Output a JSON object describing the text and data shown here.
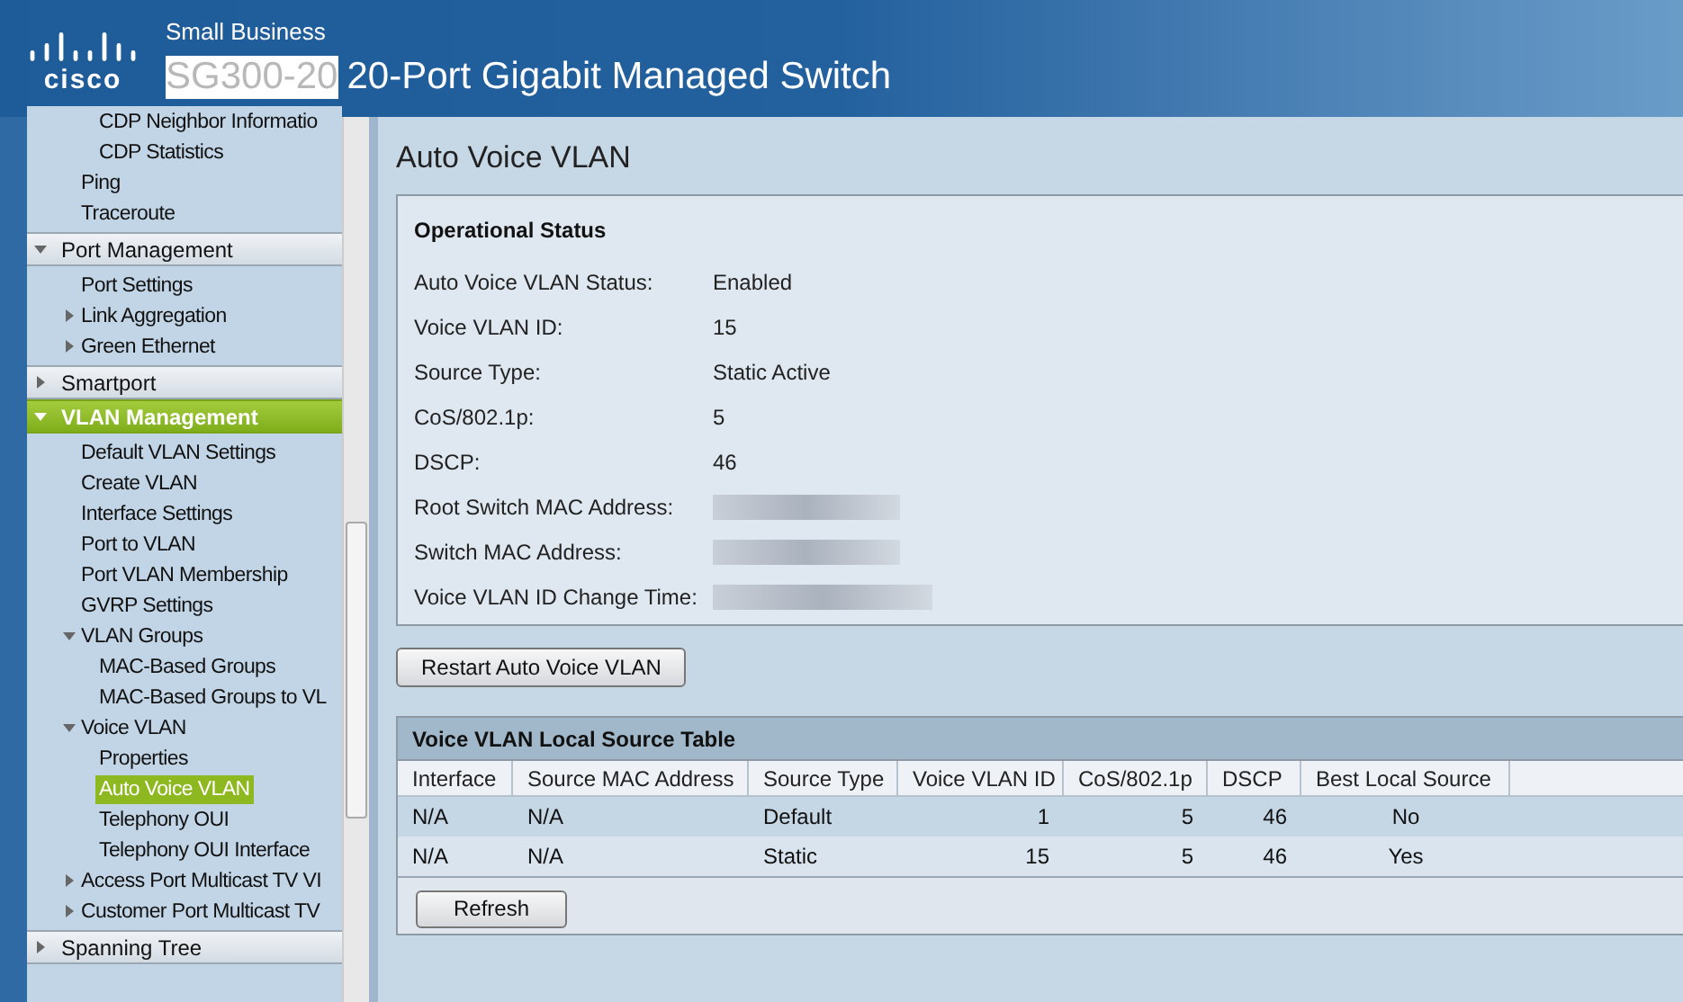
{
  "header": {
    "logo": "cisco",
    "brand": "Small Business",
    "model": "SG300-20",
    "title": "20-Port Gigabit Managed Switch"
  },
  "sidebar": {
    "sections": [
      {
        "kind": "partial",
        "children": [
          {
            "children": [
              {
                "label": "CDP Neighbor Informatio",
                "selected": false
              },
              {
                "label": "CDP Statistics",
                "selected": false
              }
            ]
          },
          {
            "label": "Ping",
            "selected": false
          },
          {
            "label": "Traceroute",
            "selected": false
          }
        ]
      },
      {
        "kind": "section",
        "label": "Port Management",
        "expanded": true,
        "selected": false,
        "children": [
          {
            "label": "Port Settings",
            "selected": false
          },
          {
            "label": "Link Aggregation",
            "expanded": false,
            "selected": false
          },
          {
            "label": "Green Ethernet",
            "expanded": false,
            "selected": false
          }
        ]
      },
      {
        "kind": "section",
        "label": "Smartport",
        "expanded": false,
        "selected": false
      },
      {
        "kind": "section",
        "label": "VLAN Management",
        "expanded": true,
        "selected": true,
        "children": [
          {
            "label": "Default VLAN Settings",
            "selected": false
          },
          {
            "label": "Create VLAN",
            "selected": false
          },
          {
            "label": "Interface Settings",
            "selected": false
          },
          {
            "label": "Port to VLAN",
            "selected": false
          },
          {
            "label": "Port VLAN Membership",
            "selected": false
          },
          {
            "label": "GVRP Settings",
            "selected": false
          },
          {
            "label": "VLAN Groups",
            "expanded": true,
            "selected": false,
            "children": [
              {
                "label": "MAC-Based Groups",
                "selected": false
              },
              {
                "label": "MAC-Based Groups to VL",
                "selected": false
              }
            ]
          },
          {
            "label": "Voice VLAN",
            "expanded": true,
            "selected": false,
            "children": [
              {
                "label": "Properties",
                "selected": false
              },
              {
                "label": "Auto Voice VLAN",
                "selected": true
              },
              {
                "label": "Telephony OUI",
                "selected": false
              },
              {
                "label": "Telephony OUI Interface",
                "selected": false
              }
            ]
          },
          {
            "label": "Access Port Multicast TV VI",
            "expanded": false,
            "selected": false
          },
          {
            "label": "Customer Port Multicast TV",
            "expanded": false,
            "selected": false
          }
        ]
      },
      {
        "kind": "section",
        "label": "Spanning Tree",
        "expanded": false,
        "selected": false
      }
    ]
  },
  "page_title": "Auto Voice VLAN",
  "operational_status": {
    "title": "Operational Status",
    "rows": [
      {
        "kind": "text",
        "label": "Auto Voice VLAN Status:",
        "value": "Enabled"
      },
      {
        "kind": "text",
        "label": "Voice VLAN ID:",
        "value": "15"
      },
      {
        "kind": "text",
        "label": "Source Type:",
        "value": "Static Active"
      },
      {
        "kind": "text",
        "label": "CoS/802.1p:",
        "value": "5"
      },
      {
        "kind": "text",
        "label": "DSCP:",
        "value": "46"
      },
      {
        "kind": "redacted",
        "label": "Root Switch MAC Address:"
      },
      {
        "kind": "redacted",
        "label": "Switch MAC Address:"
      },
      {
        "kind": "redacted",
        "label": "Voice VLAN ID Change Time:"
      }
    ]
  },
  "restart_button": "Restart Auto Voice VLAN",
  "table": {
    "title": "Voice VLAN Local Source Table",
    "columns": [
      "Interface",
      "Source MAC Address",
      "Source Type",
      "Voice VLAN ID",
      "CoS/802.1p",
      "DSCP",
      "Best Local Source"
    ],
    "rows": [
      [
        "N/A",
        "N/A",
        "Default",
        "1",
        "5",
        "46",
        "No"
      ],
      [
        "N/A",
        "N/A",
        "Static",
        "15",
        "5",
        "46",
        "Yes"
      ]
    ],
    "refresh_button": "Refresh"
  }
}
